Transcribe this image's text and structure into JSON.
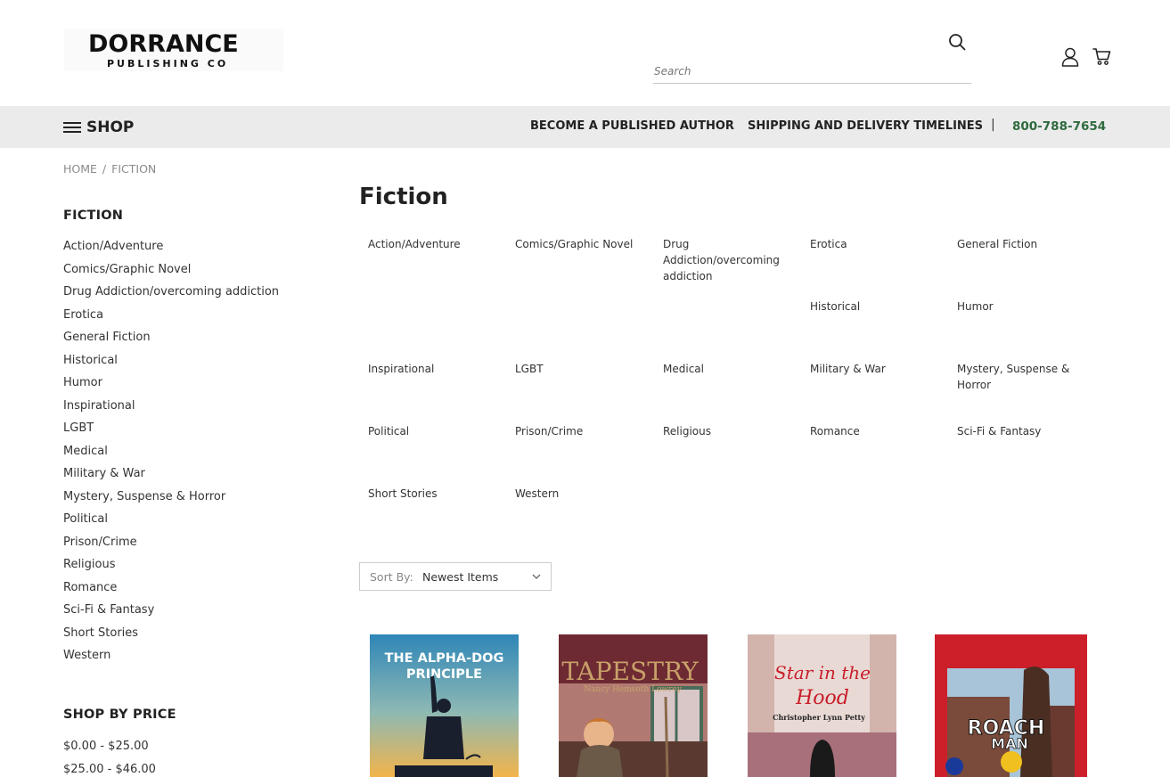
{
  "header": {
    "logo_main": "DORRANCE",
    "logo_sub": "PUBLISHING CO",
    "search_placeholder": "Search"
  },
  "nav": {
    "shop_label": "SHOP",
    "links": [
      "BECOME A PUBLISHED AUTHOR",
      "SHIPPING AND DELIVERY TIMELINES"
    ],
    "separator": "|",
    "phone": "800-788-7654",
    "phone_color": "#2e6b3e",
    "bar_color": "#ebebeb"
  },
  "breadcrumb": {
    "home": "HOME",
    "separator": "/",
    "current": "FICTION"
  },
  "sidebar": {
    "categories_heading": "FICTION",
    "categories": [
      "Action/Adventure",
      "Comics/Graphic Novel",
      "Drug Addiction/overcoming addiction",
      "Erotica",
      "General Fiction",
      "Historical",
      "Humor",
      "Inspirational",
      "LGBT",
      "Medical",
      "Military & War",
      "Mystery, Suspense & Horror",
      "Political",
      "Prison/Crime",
      "Religious",
      "Romance",
      "Sci-Fi & Fantasy",
      "Short Stories",
      "Western"
    ],
    "price_heading": "SHOP BY PRICE",
    "prices": [
      "$0.00 - $25.00",
      "$25.00 - $46.00"
    ]
  },
  "main": {
    "title": "Fiction",
    "subcategories": [
      "Action/Adventure",
      "Comics/Graphic Novel",
      "Drug Addiction/overcoming addiction",
      "Erotica",
      "General Fiction",
      "Historical",
      "Humor",
      "Inspirational",
      "LGBT",
      "Medical",
      "Military & War",
      "Mystery, Suspense & Horror",
      "Political",
      "Prison/Crime",
      "Religious",
      "Romance",
      "Sci-Fi & Fantasy",
      "Short Stories",
      "Western"
    ],
    "sort": {
      "label": "Sort By:",
      "value": "Newest Items"
    },
    "products": [
      {
        "cover_title": "THE ALPHA-DOG PRINCIPLE"
      },
      {
        "cover_title": "TAPESTRY",
        "cover_author": "Nancy Hemsoth Lowrey"
      },
      {
        "cover_title_line1": "Star in the",
        "cover_title_line2": "Hood",
        "cover_author": "Christopher Lynn Petty"
      },
      {
        "cover_title_line1": "ROACH",
        "cover_title_line2": "MAN"
      }
    ]
  }
}
